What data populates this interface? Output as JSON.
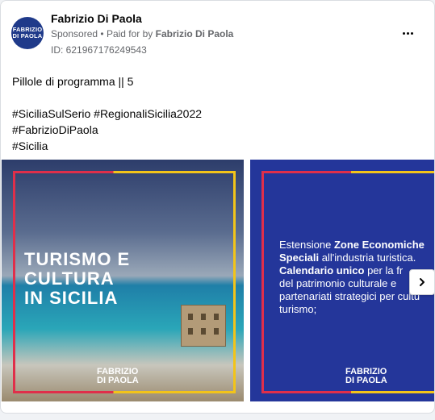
{
  "post": {
    "avatar_text_line1": "FABRIZIO",
    "avatar_text_line2": "DI PAOLA",
    "page_name": "Fabrizio Di Paola",
    "sponsored_label": "Sponsored",
    "separator": "•",
    "paid_for_prefix": "Paid for by",
    "paid_for_name": "Fabrizio Di Paola",
    "ad_id": "ID: 621967176249543",
    "body_lines": [
      "Pillole di programma || 5",
      "",
      "#SiciliaSulSerio #RegionaliSicilia2022",
      "#FabrizioDiPaola",
      "#Sicilia"
    ]
  },
  "carousel": {
    "slide1": {
      "title_lines": [
        "TURISMO E",
        "CULTURA",
        "IN SICILIA"
      ],
      "logo_line1": "FABRIZIO",
      "logo_line2": "DI PAOLA"
    },
    "slide2": {
      "text_plain_1": "Estensione ",
      "text_bold_1": "Zone Economiche Speciali",
      "text_plain_2": " all'industria turistica.",
      "text_bold_2": "Calendario unico",
      "text_plain_3": " per la fr",
      "text_plain_4": "del patrimonio culturale e",
      "text_plain_5": "partenariati strategici per cultu",
      "text_plain_6": "turismo;",
      "logo_line1": "FABRIZIO",
      "logo_line2": "DI PAOLA"
    }
  },
  "icons": {
    "menu": "more-horizontal-icon",
    "next": "chevron-right-icon"
  },
  "colors": {
    "brand_blue": "#24369a",
    "frame_red": "#e02f4a",
    "frame_yellow": "#f2c419",
    "text_primary": "#050505",
    "text_secondary": "#65676b"
  }
}
